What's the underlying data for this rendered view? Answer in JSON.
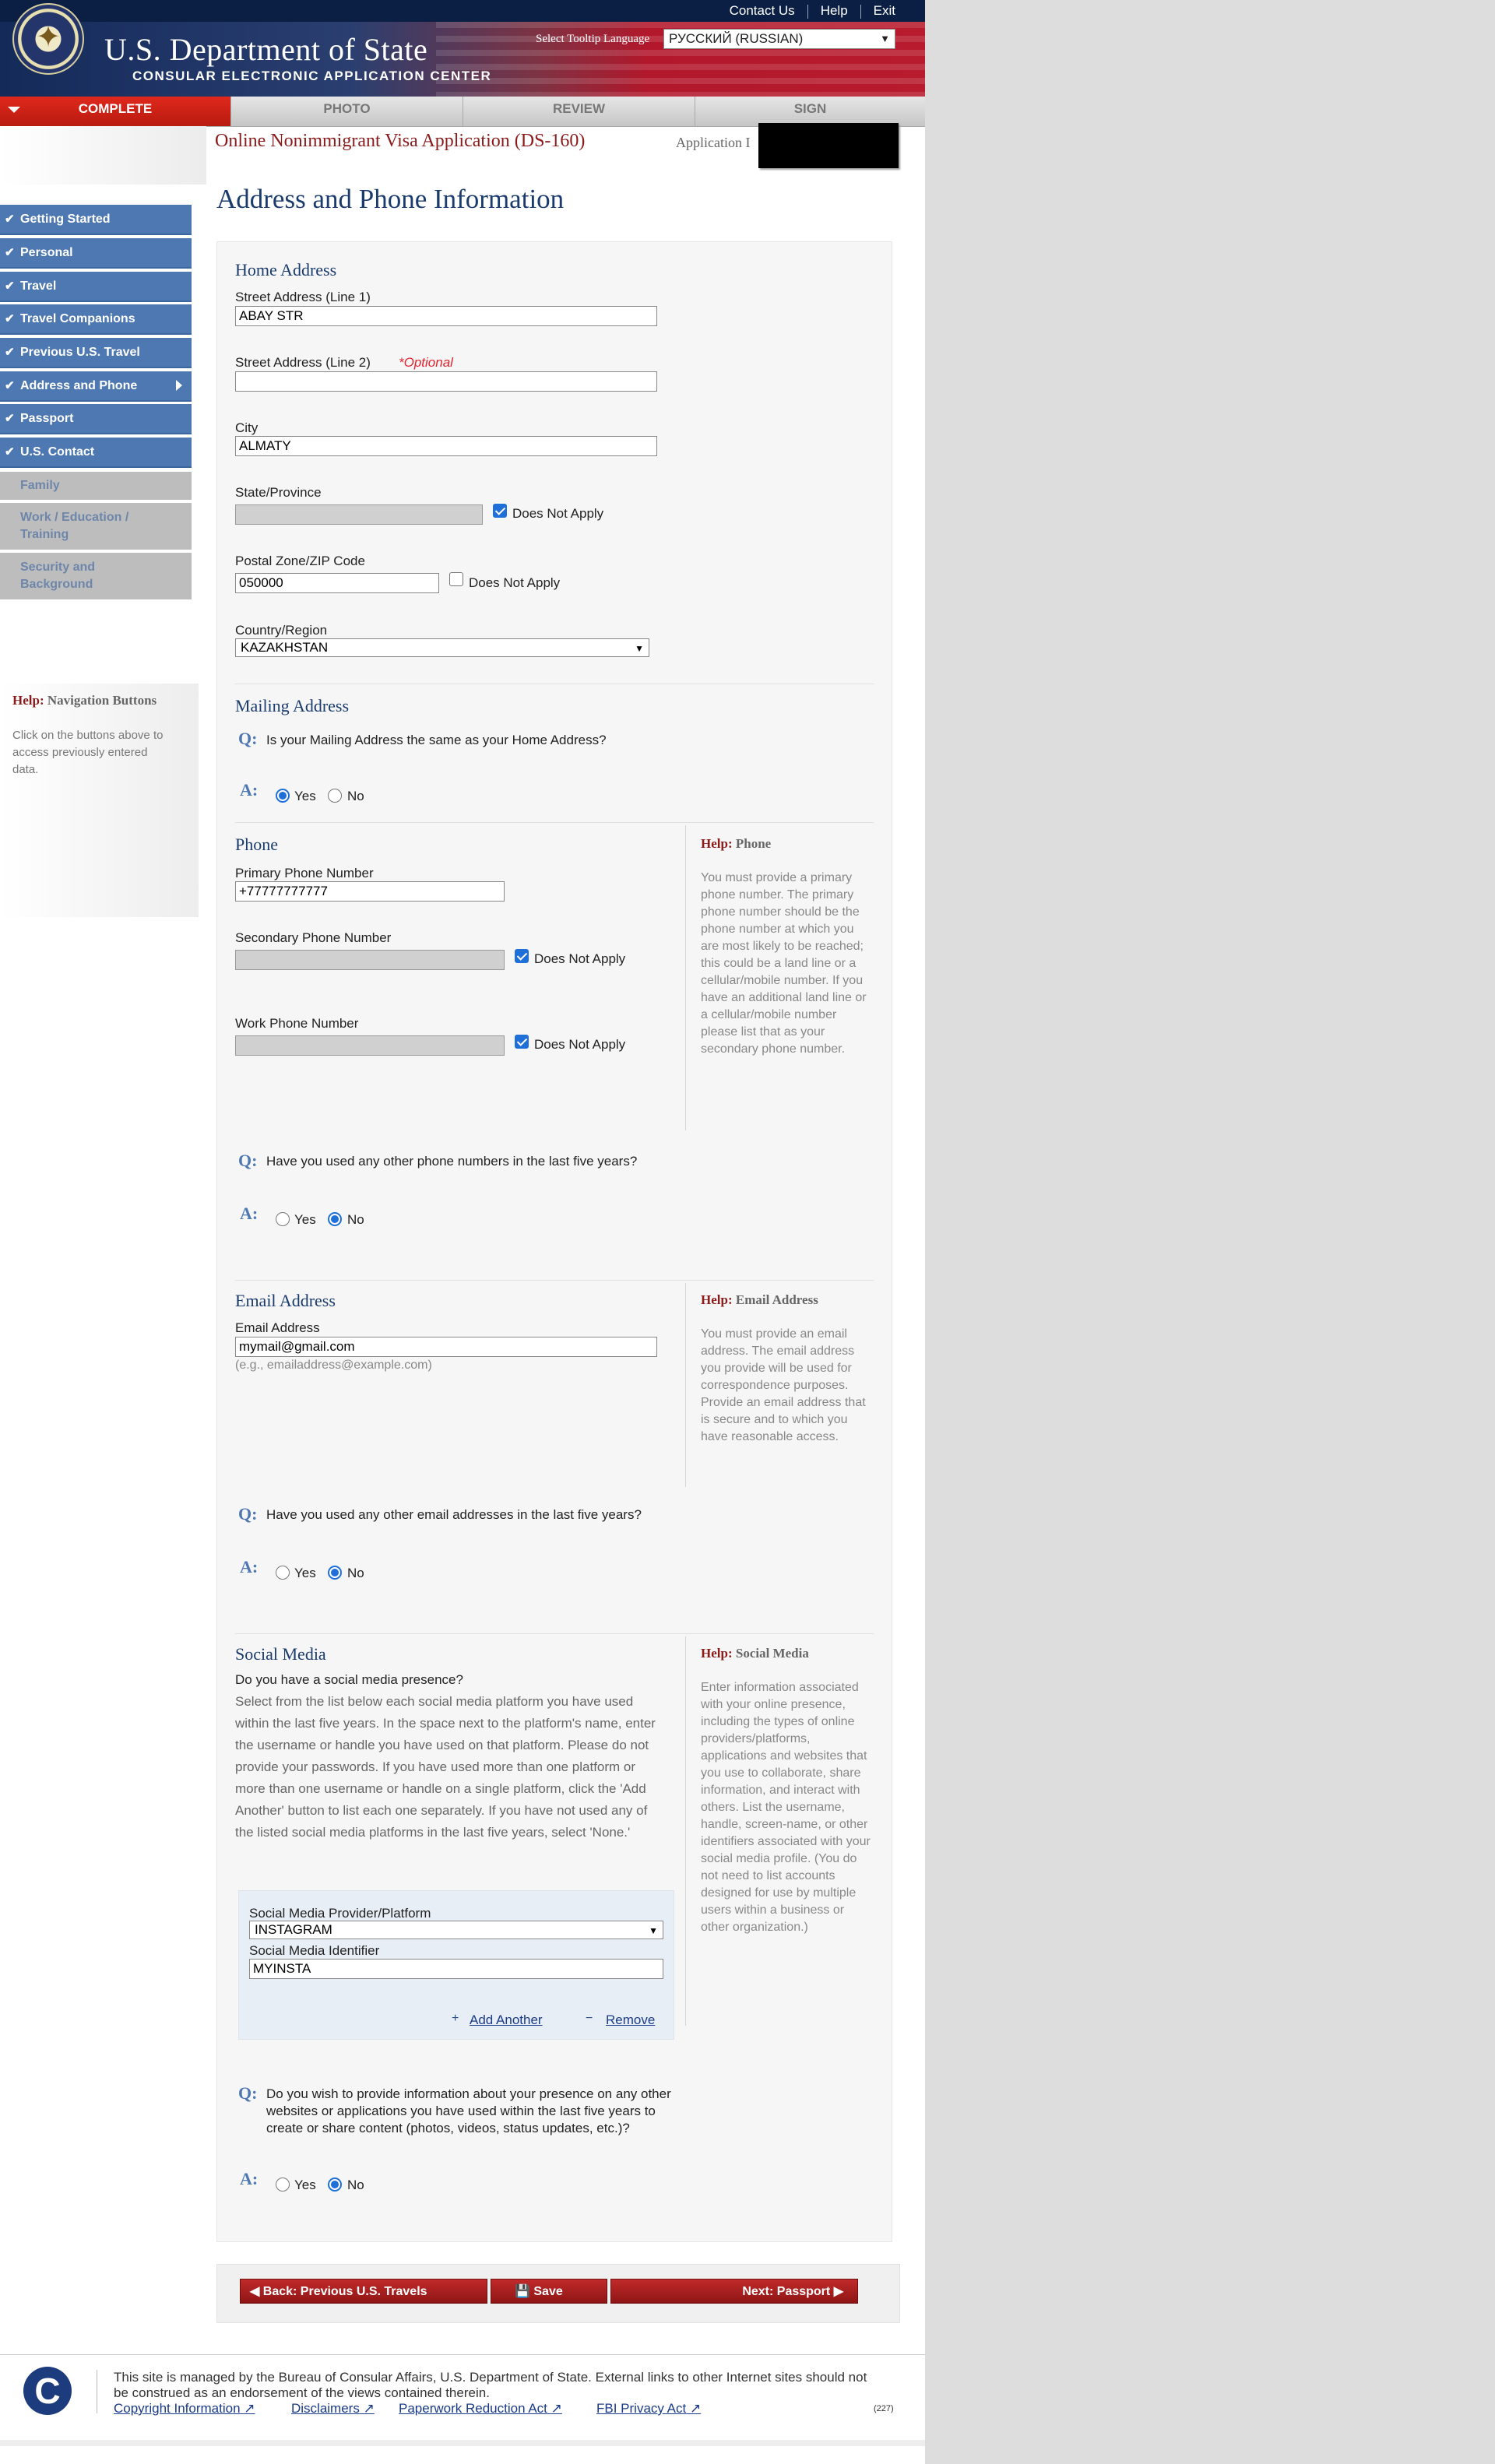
{
  "header": {
    "links": [
      "Contact Us",
      "Help",
      "Exit"
    ],
    "department": "U.S. Department of State",
    "center": "CONSULAR ELECTRONIC APPLICATION CENTER",
    "tooltip_label": "Select Tooltip Language",
    "language_value": "РУССКИЙ (RUSSIAN)"
  },
  "progress": {
    "tabs": [
      "COMPLETE",
      "PHOTO",
      "REVIEW",
      "SIGN"
    ]
  },
  "app": {
    "title": "Online Nonimmigrant Visa Application (DS-160)",
    "id_label": "Application I"
  },
  "sidebar": {
    "items": [
      {
        "label": "Getting Started",
        "status": "done"
      },
      {
        "label": "Personal",
        "status": "done"
      },
      {
        "label": "Travel",
        "status": "done"
      },
      {
        "label": "Travel Companions",
        "status": "done"
      },
      {
        "label": "Previous U.S. Travel",
        "status": "done"
      },
      {
        "label": "Address and Phone",
        "status": "current"
      },
      {
        "label": "Passport",
        "status": "done"
      },
      {
        "label": "U.S. Contact",
        "status": "done"
      },
      {
        "label": "Family",
        "status": "todo"
      },
      {
        "label": "Work / Education / Training",
        "status": "todo"
      },
      {
        "label": "Security and Background",
        "status": "todo"
      }
    ],
    "help_title_prefix": "Help:",
    "help_title": "Navigation Buttons",
    "help_text": "Click on the buttons above to access previously entered data."
  },
  "page_title": "Address and Phone Information",
  "home": {
    "title": "Home Address",
    "street1_label": "Street Address (Line 1)",
    "street1_value": "ABAY STR",
    "street2_label": "Street Address (Line 2)",
    "optional": "*Optional",
    "street2_value": "",
    "city_label": "City",
    "city_value": "ALMATY",
    "state_label": "State/Province",
    "state_dna": "Does Not Apply",
    "zip_label": "Postal Zone/ZIP Code",
    "zip_value": "050000",
    "zip_dna": "Does Not Apply",
    "country_label": "Country/Region",
    "country_value": "KAZAKHSTAN"
  },
  "mailing": {
    "title": "Mailing Address",
    "q": "Q:",
    "question": "Is your Mailing Address the same as your Home Address?",
    "a": "A:",
    "yes": "Yes",
    "no": "No",
    "selected": "yes"
  },
  "phone": {
    "title": "Phone",
    "primary_label": "Primary Phone Number",
    "primary_value": "+77777777777",
    "secondary_label": "Secondary Phone Number",
    "secondary_dna": "Does Not Apply",
    "work_label": "Work Phone Number",
    "work_dna": "Does Not Apply",
    "help_prefix": "Help:",
    "help_title": "Phone",
    "help_text": "You must provide a primary phone number. The primary phone number should be the phone number at which you are most likely to be reached; this could be a land line or a cellular/mobile number. If you have an additional land line or a cellular/mobile number please list that as your secondary phone number.",
    "q": "Q:",
    "question": "Have you used any other phone numbers in the last five years?",
    "a": "A:",
    "yes": "Yes",
    "no": "No",
    "selected": "no"
  },
  "email": {
    "title": "Email Address",
    "label": "Email Address",
    "value": "mymail@gmail.com",
    "hint": "(e.g., emailaddress@example.com)",
    "help_prefix": "Help:",
    "help_title": "Email Address",
    "help_text": "You must provide an email address.  The email address you provide will be used for correspondence purposes.  Provide an email address that is secure and to which you have reasonable access.",
    "q": "Q:",
    "question": "Have you used any other email addresses in the last five years?",
    "a": "A:",
    "yes": "Yes",
    "no": "No",
    "selected": "no"
  },
  "social": {
    "title": "Social Media",
    "question": "Do you have a social media presence?",
    "description": "Select from the list below each social media platform you have used within the last five years. In the space next to the platform's name, enter the username or handle you have used on that platform. Please do not provide your passwords. If you have used more than one platform or more than one username or handle on a single platform, click the 'Add Another' button to list each one separately. If you have not used any of the listed social media platforms in the last five years, select 'None.'",
    "provider_label": "Social Media Provider/Platform",
    "provider_value": "INSTAGRAM",
    "identifier_label": "Social Media Identifier",
    "identifier_value": "MYINSTA",
    "add_another": "Add Another",
    "remove": "Remove",
    "help_prefix": "Help:",
    "help_title": "Social Media",
    "help_text": "Enter information associated with your online presence, including the types of online providers/platforms, applications and websites that you use to collaborate, share information, and interact with others. List the username, handle, screen-name, or other identifiers associated with your social media profile. (You do not need to list accounts designed for use by multiple users within a business or other organization.)",
    "q": "Q:",
    "question2": "Do you wish to provide information about your presence on any other websites or applications you have used within the last five years to create or share content (photos, videos, status updates, etc.)?",
    "a": "A:",
    "yes": "Yes",
    "no": "No",
    "selected": "no"
  },
  "buttons": {
    "back": "Back: Previous U.S. Travels",
    "save": "Save",
    "next": "Next: Passport"
  },
  "footer": {
    "text": "This site is managed by the Bureau of Consular Affairs, U.S. Department of State. External links to other Internet sites should not be construed as an endorsement of the views contained therein.",
    "links": [
      "Copyright Information",
      "Disclaimers",
      "Paperwork Reduction Act",
      "FBI Privacy Act"
    ],
    "code": "(227)"
  }
}
